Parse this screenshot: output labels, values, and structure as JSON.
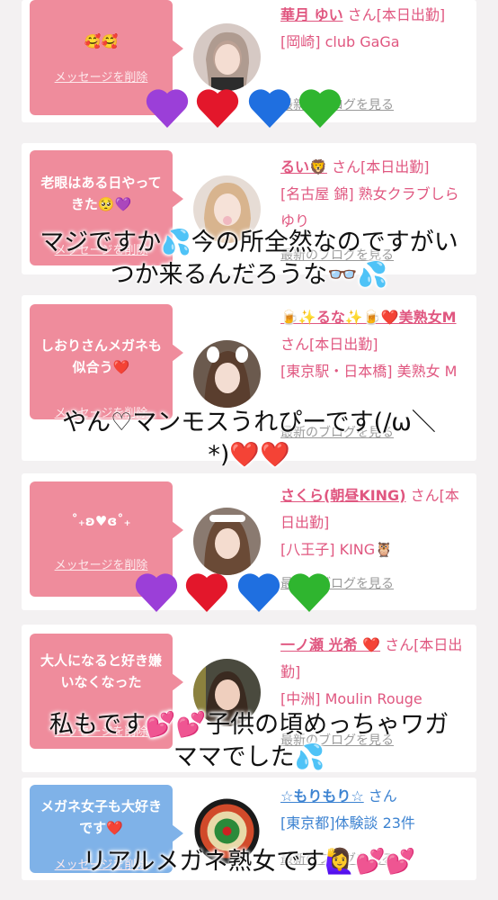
{
  "cards": [
    {
      "message": "🥰🥰",
      "delete": "メッセージを削除",
      "name": "華月 ゆい",
      "suffix": "さん[本日出勤]",
      "location": "[岡崎] club GaGa",
      "blog": "最新のブログを見る"
    },
    {
      "message": "老眼はある日やってきた🥺💜",
      "delete": "メッセージを削除",
      "name": "るい🦁",
      "suffix": "さん[本日出勤]",
      "location": "[名古屋 錦] 熟女クラブしらゆり",
      "blog": "最新のブログを見る"
    },
    {
      "message": "しおりさんメガネも似合う❤️",
      "delete": "メッセージを削除",
      "name": "🍺✨るな✨🍺❤️美熟女M",
      "suffix": "さん[本日出勤]",
      "location": "[東京駅・日本橋] 美熟女 M",
      "blog": "最新のブログを見る"
    },
    {
      "message": "˚₊ʚ♥ɞ˚₊",
      "delete": "メッセージを削除",
      "name": "さくら(朝昼KING)",
      "suffix": "さん[本日出勤]",
      "location": "[八王子] KING🦉",
      "blog": "最新のブログを見る"
    },
    {
      "message": "大人になると好き嫌いなくなった",
      "delete": "メッセージを削除",
      "name": "一ノ瀬 光希 ❤️",
      "suffix": "さん[本日出勤]",
      "location": "[中洲] Moulin Rouge",
      "blog": "最新のブログを見る"
    },
    {
      "message": "メガネ女子も大好きです❤️",
      "delete": "メッセージを削除",
      "name": "☆もりもり☆",
      "suffix": "さん",
      "location": "[東京都]体験談 23件",
      "blog": "最新のブログを見る"
    }
  ],
  "overlays": {
    "comment1_line1": "マジですか💦今の所全然なのですがい",
    "comment1_line2": "つか来るんだろうな👓💦",
    "comment2_line1": "やん♡マンモスうれぴーです(/ω＼",
    "comment2_line2": "*)❤️❤️",
    "comment3_line1": "私もです💕💕子供の頃めっちゃワガ",
    "comment3_line2": "ママでした💦",
    "comment4": "リアルメガネ熟女です🙋‍♀️💕💕"
  },
  "heart_colors": [
    "#9b3fd8",
    "#e3172b",
    "#1f6fe0",
    "#2fb52f"
  ]
}
